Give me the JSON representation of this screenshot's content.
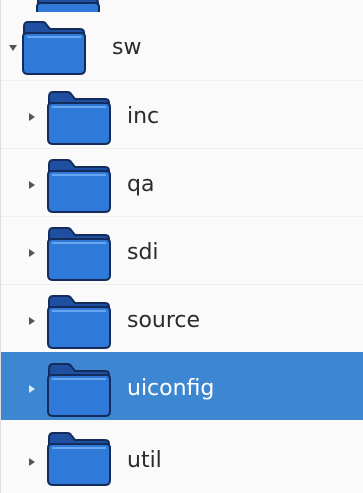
{
  "tree": {
    "root": {
      "label": "sw",
      "expanded": true,
      "icon": "folder-icon"
    },
    "children": [
      {
        "label": "inc",
        "icon": "folder-icon",
        "expanded": false,
        "selected": false
      },
      {
        "label": "qa",
        "icon": "folder-icon",
        "expanded": false,
        "selected": false
      },
      {
        "label": "sdi",
        "icon": "folder-icon",
        "expanded": false,
        "selected": false
      },
      {
        "label": "source",
        "icon": "folder-icon",
        "expanded": false,
        "selected": false
      },
      {
        "label": "uiconfig",
        "icon": "folder-icon",
        "expanded": false,
        "selected": true
      },
      {
        "label": "util",
        "icon": "folder-icon",
        "expanded": false,
        "selected": false
      }
    ],
    "colors": {
      "selection": "#3d86d1",
      "folder_body": "#2f79d8",
      "folder_tab": "#1f4fa0",
      "folder_outline": "#142c5c",
      "label_text": "#2b2b2b",
      "selected_text": "#ffffff"
    }
  }
}
